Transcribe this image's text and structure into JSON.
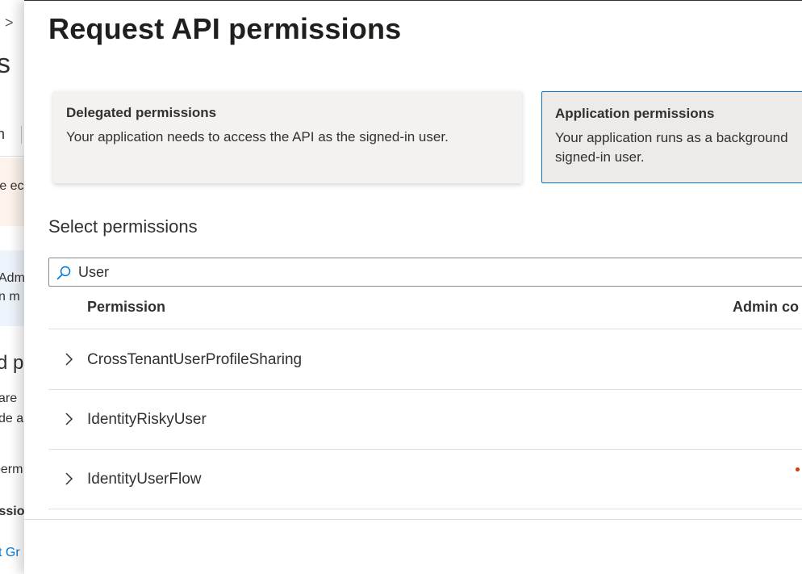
{
  "background": {
    "chevron": ">",
    "title_fragment": "s",
    "tab_fragment": "n",
    "warning_fragment": "re ec",
    "info_line1": "Adm",
    "info_line2": "n m",
    "heading_fragment": "d p",
    "para_line1": "are",
    "para_line2": "de a",
    "perm_fragment": "perm",
    "bold_fragment": "issio",
    "link_fragment": "t Gr"
  },
  "panel": {
    "title": "Request API permissions",
    "cards": {
      "delegated": {
        "title": "Delegated permissions",
        "description": "Your application needs to access the API as the signed-in user."
      },
      "application": {
        "title": "Application permissions",
        "description_line1": "Your application runs as a background",
        "description_line2": "signed-in user."
      }
    },
    "section_title": "Select permissions",
    "search": {
      "value": "User",
      "icon": "search-icon"
    },
    "table": {
      "headers": {
        "permission": "Permission",
        "admin_consent": "Admin co"
      },
      "rows": [
        {
          "label": "CrossTenantUserProfileSharing"
        },
        {
          "label": "IdentityRiskyUser"
        },
        {
          "label": "IdentityUserFlow"
        }
      ]
    }
  },
  "colors": {
    "accent": "#0078d4",
    "warning_dot": "#d83b01"
  }
}
